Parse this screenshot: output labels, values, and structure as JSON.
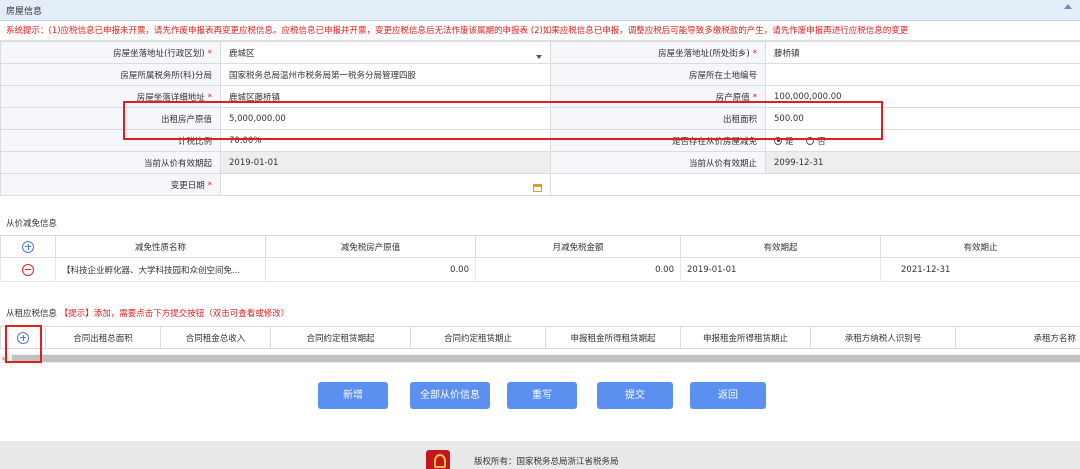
{
  "house_section": {
    "title": "房屋信息",
    "notice": "系统提示：(1)应税信息已申报未开票，请先作废申报表再变更应税信息。应税信息已申报并开票，变更应税信息后无法作废该属期的申报表 (2)如果应税信息已申报，调整应税后可能导致多缴税款的产生，请先作废申报再进行应税信息的变更",
    "fields": {
      "location_district_label": "房屋坐落地址(行政区划)",
      "location_district_value": "鹿城区",
      "location_street_label": "房屋坐落地址(所处街乡)",
      "location_street_value": "藤桥镇",
      "tax_office_label": "房屋所属税务所(科)分局",
      "tax_office_value": "国家税务总局温州市税务局第一税务分局管理四股",
      "land_number_label": "房屋所在土地编号",
      "land_number_value": "",
      "detail_address_label": "房屋坐落详细地址",
      "detail_address_value": "鹿城区藤桥镇",
      "property_value_label": "房产原值",
      "property_value_value": "100,000,000.00",
      "rent_original_label": "出租房产原值",
      "rent_original_value": "5,000,000.00",
      "rent_area_label": "出租面积",
      "rent_area_value": "500.00",
      "tax_ratio_label": "计税比例",
      "tax_ratio_value": "70.00%",
      "exemption_label": "是否存在从价房屋减免",
      "exemption_yes": "是",
      "exemption_no": "否",
      "exemption_selected": "是",
      "valid_from_label": "当前从价有效期起",
      "valid_from_value": "2019-01-01",
      "valid_to_label": "当前从价有效期止",
      "valid_to_value": "2099-12-31",
      "change_date_label": "变更日期",
      "change_date_value": ""
    }
  },
  "ad_valorem_section": {
    "title": "从价减免信息",
    "columns": [
      "减免性质名称",
      "减免税房产原值",
      "月减免税金额",
      "有效期起",
      "有效期止"
    ],
    "rows": [
      {
        "name": "【科技企业孵化器、大学科技园和众创空间免...",
        "original_value": "0.00",
        "monthly_amount": "0.00",
        "valid_from": "2019-01-01",
        "valid_to": "2021-12-31"
      }
    ]
  },
  "rent_section": {
    "title": "从租应税信息",
    "hint": "【提示】添加，需要点击下方提交按钮（双击可查看或修改）",
    "columns": [
      "合同出租总面积",
      "合同租金总收入",
      "合同约定租赁期起",
      "合同约定租赁期止",
      "申报租金所得租赁期起",
      "申报租金所得租赁期止",
      "承租方纳税人识别号",
      "承租方名称"
    ],
    "scroll_left": "‹"
  },
  "buttons": {
    "add": "新增",
    "all_ad_valorem": "全部从价信息",
    "reset": "重写",
    "submit": "提交",
    "back": "返回"
  },
  "footer": {
    "copyright": "版权所有：国家税务总局浙江省税务局"
  },
  "colors": {
    "accent_blue": "#5b8ff0",
    "header_bg": "#e3eef8",
    "alert_red": "#e02020"
  }
}
